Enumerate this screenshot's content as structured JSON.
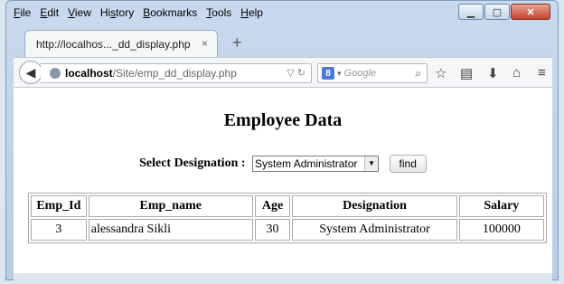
{
  "menu": [
    "File",
    "Edit",
    "View",
    "History",
    "Bookmarks",
    "Tools",
    "Help"
  ],
  "menu_access": [
    "F",
    "E",
    "V",
    "s",
    "B",
    "T",
    "H"
  ],
  "tab": {
    "title": "http://localhos..._dd_display.php",
    "close": "×",
    "new": "+"
  },
  "url": {
    "host": "localhost",
    "path": "/Site/emp_dd_display.php"
  },
  "search": {
    "engine_badge": "8",
    "placeholder": "Google"
  },
  "page": {
    "title": "Employee Data",
    "select_label": "Select Designation :",
    "select_value": "System Administrator",
    "find_label": "find"
  },
  "table": {
    "headers": [
      "Emp_Id",
      "Emp_name",
      "Age",
      "Designation",
      "Salary"
    ],
    "rows": [
      [
        "3",
        "alessandra Sikli",
        "30",
        "System Administrator",
        "100000"
      ]
    ]
  }
}
